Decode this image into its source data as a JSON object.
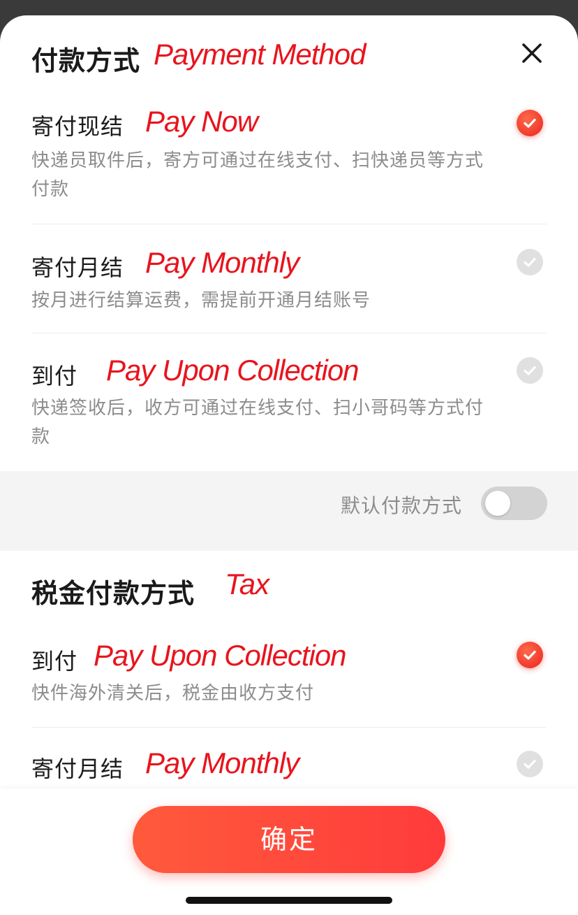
{
  "payment": {
    "title": "付款方式",
    "title_note": "Payment Method",
    "options": [
      {
        "title": "寄付现结",
        "note": "Pay Now",
        "description": "快递员取件后，寄方可通过在线支付、扫快递员等方式付款",
        "selected": true
      },
      {
        "title": "寄付月结",
        "note": "Pay Monthly",
        "description": "按月进行结算运费，需提前开通月结账号",
        "selected": false
      },
      {
        "title": "到付",
        "note": "Pay Upon Collection",
        "description": "快递签收后，收方可通过在线支付、扫小哥码等方式付款",
        "selected": false
      }
    ],
    "default_label": "默认付款方式",
    "default_enabled": false
  },
  "tax": {
    "title": "税金付款方式",
    "title_note": "Tax",
    "options": [
      {
        "title": "到付",
        "note": "Pay Upon Collection",
        "description": "快件海外清关后，税金由收方支付",
        "selected": true
      },
      {
        "title": "寄付月结",
        "note": "Pay Monthly",
        "selected": false
      }
    ]
  },
  "footer": {
    "confirm_label": "确定"
  },
  "colors": {
    "accent": "#ff3b3b",
    "annotation": "#e8141d",
    "text_primary": "#1a1a1a",
    "text_secondary": "#8c8c8c"
  }
}
